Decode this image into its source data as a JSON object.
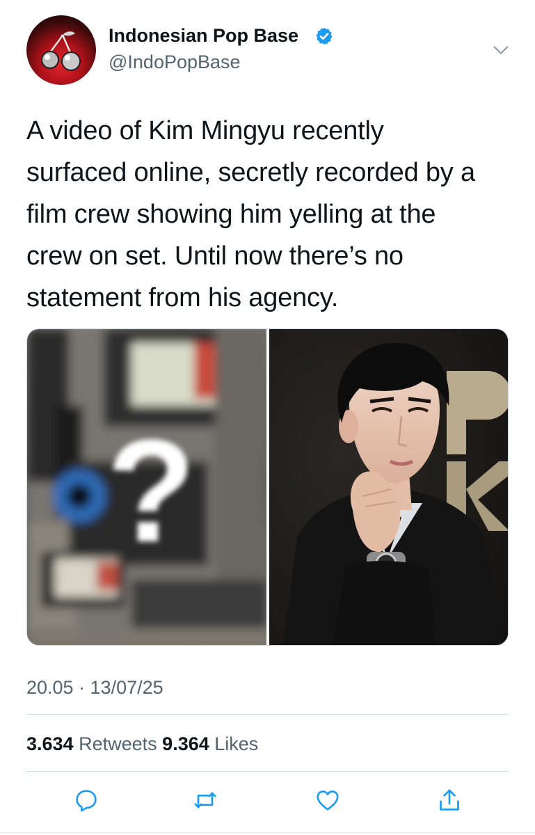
{
  "tweet": {
    "author": {
      "display_name": "Indonesian Pop Base",
      "handle": "@IndoPopBase",
      "verified": true,
      "avatar_icon": "cherries-logo-icon"
    },
    "text_lines": [
      "A video of Kim Mingyu recently",
      "surfaced online, secretly recorded by a",
      "film crew showing him yelling at the",
      "crew on set. Until now there’s no",
      "statement from his agency."
    ],
    "media": {
      "left_image": {
        "description_icon": "question-mark-icon",
        "overlay_glyph": "?"
      },
      "right_image": {
        "description_icon": "portrait-photo"
      }
    },
    "timestamp": "20.05 · 13/07/25",
    "stats": {
      "retweets_count": "3.634",
      "retweets_label": "Retweets",
      "likes_count": "9.364",
      "likes_label": "Likes"
    },
    "actions": [
      {
        "name": "reply-icon"
      },
      {
        "name": "retweet-icon"
      },
      {
        "name": "like-icon"
      },
      {
        "name": "share-icon"
      }
    ],
    "colors": {
      "text_primary": "#0f1419",
      "text_secondary": "#536471",
      "verified_blue": "#1d9bf0",
      "divider": "#cfd9de",
      "action_icon": "#1d9bf0"
    }
  }
}
